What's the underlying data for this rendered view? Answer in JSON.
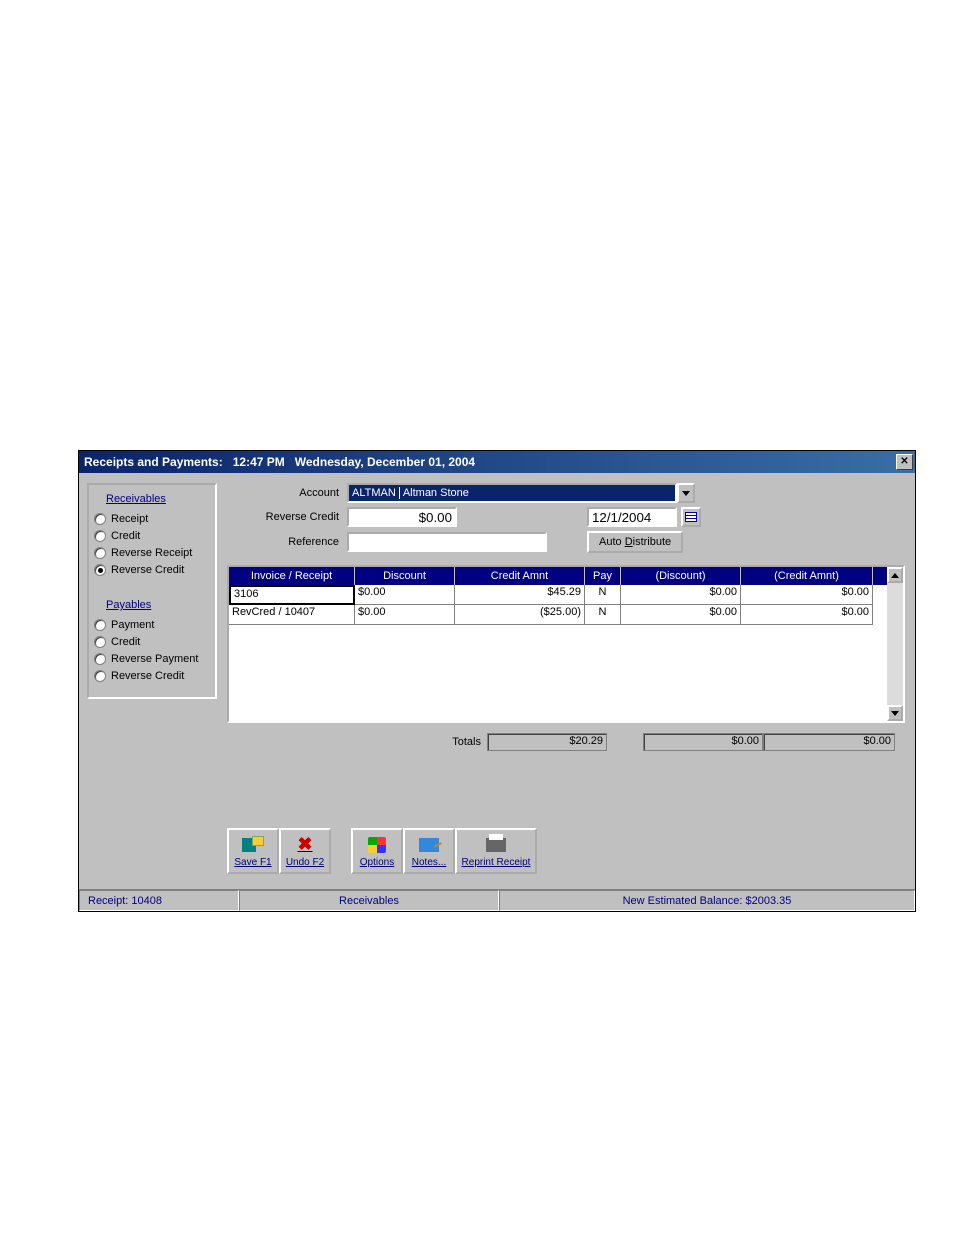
{
  "title": {
    "prefix": "Receipts and Payments:",
    "time": "12:47 PM",
    "date": "Wednesday, December 01, 2004"
  },
  "sidebar": {
    "receivables_head": "Receivables",
    "payables_head": "Payables",
    "receivables": [
      "Receipt",
      "Credit",
      "Reverse Receipt",
      "Reverse Credit"
    ],
    "payables": [
      "Payment",
      "Credit",
      "Reverse Payment",
      "Reverse Credit"
    ],
    "selected": "Reverse Credit"
  },
  "form": {
    "account_label": "Account",
    "account_code": "ALTMAN",
    "account_name": "Altman Stone",
    "reverse_label": "Reverse Credit",
    "reverse_value": "$0.00",
    "date_value": "12/1/2004",
    "reference_label": "Reference",
    "reference_value": "",
    "auto_dist_label": "Auto Distribute",
    "auto_dist_ul": "D"
  },
  "grid": {
    "cols": [
      "Invoice / Receipt",
      "Discount",
      "Credit Amnt",
      "Pay",
      "(Discount)",
      "(Credit Amnt)"
    ],
    "rows": [
      {
        "inv": "3106",
        "disc": "$0.00",
        "credit": "$45.29",
        "pay": "N",
        "pdisc": "$0.00",
        "pcred": "$0.00"
      },
      {
        "inv": "RevCred / 10407",
        "disc": "$0.00",
        "credit": "($25.00)",
        "pay": "N",
        "pdisc": "$0.00",
        "pcred": "$0.00"
      }
    ],
    "totals_label": "Totals",
    "totals": {
      "credit": "$20.29",
      "pdisc": "$0.00",
      "pcred": "$0.00"
    }
  },
  "toolbar": {
    "save": "Save F1",
    "undo": "Undo F2",
    "options": "Options",
    "notes": "Notes...",
    "reprint": "Reprint Receipt"
  },
  "status": {
    "receipt": "Receipt:  10408",
    "module": "Receivables",
    "balance": "New Estimated Balance:  $2003.35"
  }
}
